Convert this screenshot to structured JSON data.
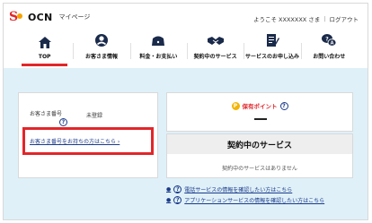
{
  "header": {
    "logo_text": "OCN",
    "logo_sub": "マイページ",
    "greeting": "ようこそ XXXXXXX さま",
    "separator": "|",
    "logout": "ログアウト"
  },
  "nav": {
    "items": [
      {
        "label": "TOP",
        "icon": "home-icon",
        "active": true
      },
      {
        "label": "お客さま情報",
        "icon": "user-icon"
      },
      {
        "label": "料金・お支払い",
        "icon": "wallet-icon"
      },
      {
        "label": "契約中のサービス",
        "icon": "handshake-icon"
      },
      {
        "label": "サービスのお申し込み",
        "icon": "application-form-icon"
      },
      {
        "label": "お問い合わせ",
        "icon": "contact-chat-icon"
      }
    ]
  },
  "customer": {
    "label": "お客さま番号",
    "status": "未登録",
    "help": "?",
    "link": "お客さま番号をお持ちの方はこちら ›"
  },
  "points": {
    "coin": "P",
    "title": "保有ポイント",
    "help": "?"
  },
  "services": {
    "title": "契約中のサービス",
    "empty": "契約中のサービスはありません"
  },
  "links": [
    {
      "bullet": "●",
      "text": "電話サービスの情報を確認したい方はこちら",
      "help": "?"
    },
    {
      "bullet": "●",
      "text": "アプリケーションサービスの情報を確認したい方はこちら",
      "help": "?"
    }
  ],
  "colors": {
    "brand_red": "#e2262a",
    "accent_blue": "#1a3a8a",
    "content_bg": "#dff0f8",
    "coin_yellow": "#f4b400"
  }
}
